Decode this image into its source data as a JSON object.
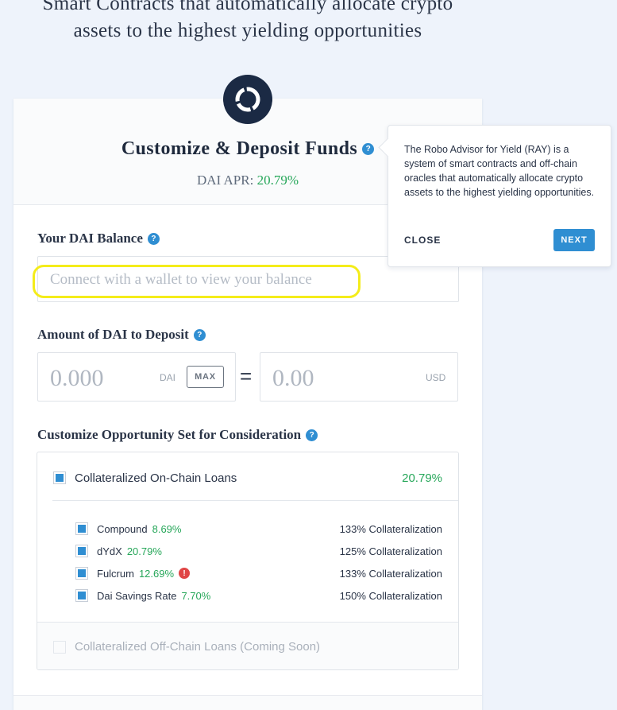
{
  "hero": {
    "line1": "Smart Contracts that automatically allocate crypto",
    "line2": "assets to the highest yielding opportunities"
  },
  "card": {
    "title": "Customize & Deposit Funds",
    "apr_label": "DAI APR:",
    "apr_value": "20.79%"
  },
  "balance": {
    "label": "Your DAI Balance",
    "placeholder": "Connect with a wallet to view your balance"
  },
  "deposit": {
    "label": "Amount of DAI to Deposit",
    "dai_value": "0.000",
    "dai_unit": "DAI",
    "max_label": "MAX",
    "equals": "=",
    "usd_value": "0.00",
    "usd_unit": "USD"
  },
  "opportunities": {
    "label": "Customize Opportunity Set for Consideration",
    "group": {
      "label": "Collateralized On-Chain Loans",
      "rate": "20.79%",
      "checked": true
    },
    "items": [
      {
        "name": "Compound",
        "rate": "8.69%",
        "collateral": "133% Collateralization",
        "warning": false
      },
      {
        "name": "dYdX",
        "rate": "20.79%",
        "collateral": "125% Collateralization",
        "warning": false
      },
      {
        "name": "Fulcrum",
        "rate": "12.69%",
        "collateral": "133% Collateralization",
        "warning": true
      },
      {
        "name": "Dai Savings Rate",
        "rate": "7.70%",
        "collateral": "150% Collateralization",
        "warning": false
      }
    ],
    "coming_soon": "Collateralized Off-Chain Loans (Coming Soon)"
  },
  "tooltip": {
    "text": "The Robo Advisor for Yield (RAY) is a system of smart contracts and off-chain oracles that automatically allocate crypto assets to the highest yielding opportunities.",
    "close_label": "CLOSE",
    "next_label": "NEXT"
  },
  "icons": {
    "help": "?",
    "warning": "!"
  },
  "colors": {
    "accent": "#2f8ed2",
    "positive": "#27a75a",
    "warning": "#e04646",
    "highlight": "#f4ec1a",
    "logo_bg": "#1b2a44"
  }
}
